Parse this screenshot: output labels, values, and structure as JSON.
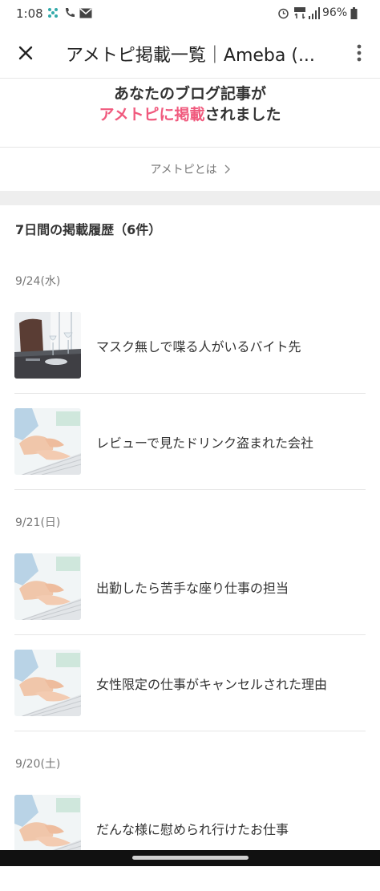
{
  "status_bar": {
    "time": "1:08",
    "battery": "96%",
    "icons": [
      "pinwheel-icon",
      "wifi-calling-icon",
      "gmail-icon",
      "alarm-icon",
      "volte-icon",
      "signal-icon",
      "battery-icon"
    ]
  },
  "app_bar": {
    "title": "アメトピ掲載一覧｜Ameba (...",
    "close_icon": "close-icon",
    "more_icon": "more-vertical-icon"
  },
  "hero": {
    "line1": "あなたのブログ記事が",
    "line2_highlight": "アメトピに掲載",
    "line2_rest": "されました",
    "accent_color": "#f05a7e"
  },
  "about_link": {
    "label": "アメトピとは"
  },
  "history": {
    "section_title": "7日間の掲載履歴（6件）",
    "groups": [
      {
        "date": "9/24(水)",
        "entries": [
          {
            "title": "マスク無しで喋る人がいるバイト先",
            "thumb": "restaurant-table-thumbnail"
          },
          {
            "title": "レビューで見たドリンク盗まれた会社",
            "thumb": "typing-keyboard-thumbnail"
          }
        ]
      },
      {
        "date": "9/21(日)",
        "entries": [
          {
            "title": "出勤したら苦手な座り仕事の担当",
            "thumb": "typing-keyboard-thumbnail"
          },
          {
            "title": "女性限定の仕事がキャンセルされた理由",
            "thumb": "typing-keyboard-thumbnail"
          }
        ]
      },
      {
        "date": "9/20(土)",
        "entries": [
          {
            "title": "だんな様に慰められ行けたお仕事",
            "thumb": "typing-keyboard-thumbnail"
          }
        ]
      }
    ]
  }
}
